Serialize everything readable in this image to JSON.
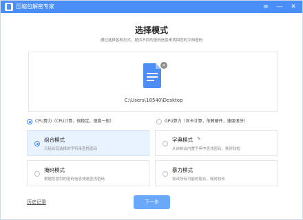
{
  "window": {
    "title": "压缩包解密专家",
    "controls": {
      "menu": "≡",
      "minimize": "—",
      "close": "✕"
    }
  },
  "header": {
    "title": "选择模式",
    "subtitle": "通过选择各种方式，提供不同的密码信息来找回您的文档密码"
  },
  "file": {
    "path": "C:\\Users\\18540\\Desktop",
    "icon": "document-icon",
    "remove": "×"
  },
  "compute": {
    "options": [
      {
        "label": "CPU算力（CPU计算，很稳定，速度一般）",
        "selected": true
      },
      {
        "label": "GPU算力（显卡计算，依赖硬件，速度很快）",
        "selected": false
      }
    ]
  },
  "modes": [
    {
      "name": "组合模式",
      "desc": "只组合您选择的字符来查找密码",
      "selected": true
    },
    {
      "name": "字典模式",
      "desc": "从自制会内置字典中查找密码，耗时较短",
      "selected": false
    },
    {
      "name": "掩码模式",
      "desc": "根据您提供的密码信息快速查找密码",
      "selected": false
    },
    {
      "name": "暴力模式",
      "desc": "尝试所有可能的组合，耗时较长",
      "selected": false
    }
  ],
  "footer": {
    "history": "历史记录",
    "next": "下一步"
  },
  "colors": {
    "accent": "#4a8ff7",
    "button": "#6aa8fa",
    "selected_bg": "#e9f2ff"
  }
}
